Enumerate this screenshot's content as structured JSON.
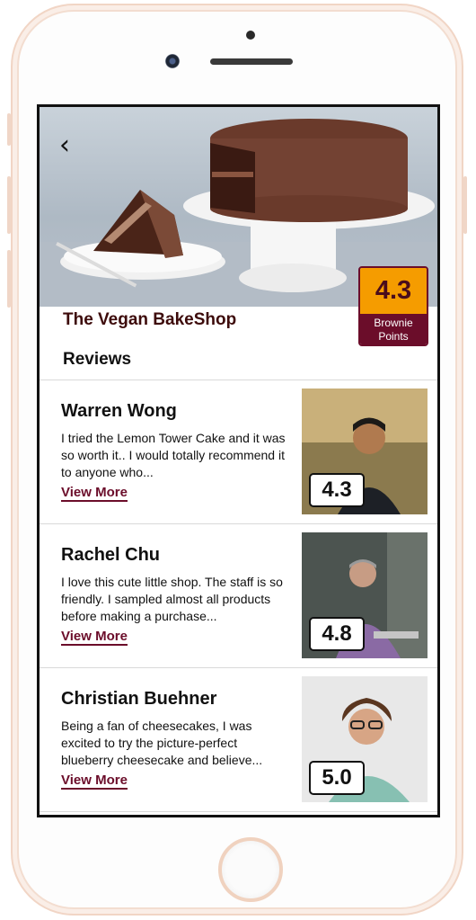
{
  "shop": {
    "title": "The Vegan BakeShop",
    "rating": "4.3",
    "rating_label": "Brownie Points"
  },
  "reviews_heading": "Reviews",
  "reviews": [
    {
      "name": "Warren Wong",
      "text": "I tried the Lemon Tower Cake and it was so worth it.. I would totally recommend it to anyone who...",
      "more": "View More",
      "score": "4.3"
    },
    {
      "name": "Rachel Chu",
      "text": "I love this cute little shop. The staff is so friendly. I sampled almost all products before making a purchase...",
      "more": "View More",
      "score": "4.8"
    },
    {
      "name": "Christian Buehner",
      "text": "Being a fan of cheesecakes, I was excited to try the picture-perfect blueberry cheesecake and believe...",
      "more": "View More",
      "score": "5.0"
    }
  ],
  "icons": {
    "back": "chevron-left-icon"
  },
  "colors": {
    "accent": "#6b0d2a",
    "rating_bg": "#f59c00",
    "title": "#3d0b0b"
  }
}
